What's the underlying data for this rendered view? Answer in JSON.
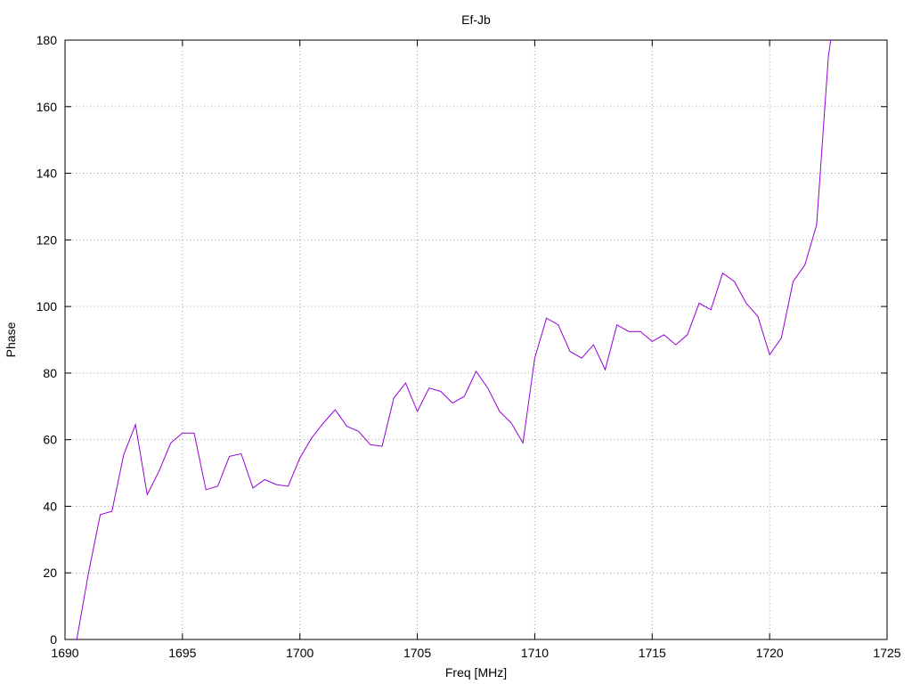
{
  "chart_data": {
    "type": "line",
    "title": "Ef-Jb",
    "xlabel": "Freq [MHz]",
    "ylabel": "Phase",
    "xlim": [
      1690,
      1725
    ],
    "ylim": [
      0,
      180
    ],
    "xticks": [
      1690,
      1695,
      1700,
      1705,
      1710,
      1715,
      1720,
      1725
    ],
    "yticks": [
      0,
      20,
      40,
      60,
      80,
      100,
      120,
      140,
      160,
      180
    ],
    "grid": true,
    "series": [
      {
        "color": "#9400d3",
        "x": [
          1690.5,
          1691.0,
          1691.5,
          1692.0,
          1692.5,
          1693.0,
          1693.5,
          1694.0,
          1694.5,
          1695.0,
          1695.5,
          1696.0,
          1696.5,
          1697.0,
          1697.5,
          1698.0,
          1698.5,
          1699.0,
          1699.5,
          1700.0,
          1700.5,
          1701.0,
          1701.5,
          1702.0,
          1702.5,
          1703.0,
          1703.5,
          1704.0,
          1704.5,
          1705.0,
          1705.5,
          1706.0,
          1706.5,
          1707.0,
          1707.5,
          1708.0,
          1708.5,
          1709.0,
          1709.5,
          1710.0,
          1710.5,
          1711.0,
          1711.5,
          1712.0,
          1712.5,
          1713.0,
          1713.5,
          1714.0,
          1714.5,
          1715.0,
          1715.5,
          1716.0,
          1716.5,
          1717.0,
          1717.5,
          1718.0,
          1718.5,
          1719.0,
          1719.5,
          1720.0,
          1720.5,
          1721.0,
          1721.5,
          1722.0,
          1722.5,
          1722.6
        ],
        "y": [
          0,
          20,
          37.5,
          38.5,
          55.5,
          64.5,
          43.5,
          50.5,
          59.0,
          62.0,
          62.0,
          45.0,
          46.0,
          55.0,
          55.8,
          45.5,
          48.0,
          46.5,
          46.0,
          54.5,
          60.5,
          65.0,
          69.0,
          64.0,
          62.5,
          58.5,
          58.0,
          72.5,
          77.0,
          68.5,
          75.5,
          74.5,
          71.0,
          73.0,
          80.5,
          75.5,
          68.5,
          65.0,
          59.0,
          84.5,
          96.5,
          94.5,
          86.5,
          84.5,
          88.5,
          81.0,
          94.5,
          92.5,
          92.5,
          89.5,
          91.5,
          88.5,
          91.5,
          101.0,
          99.0,
          110.0,
          107.5,
          101.0,
          97.0,
          85.5,
          90.5,
          107.5,
          112.5,
          124.5,
          175.0,
          180.0
        ]
      }
    ]
  }
}
